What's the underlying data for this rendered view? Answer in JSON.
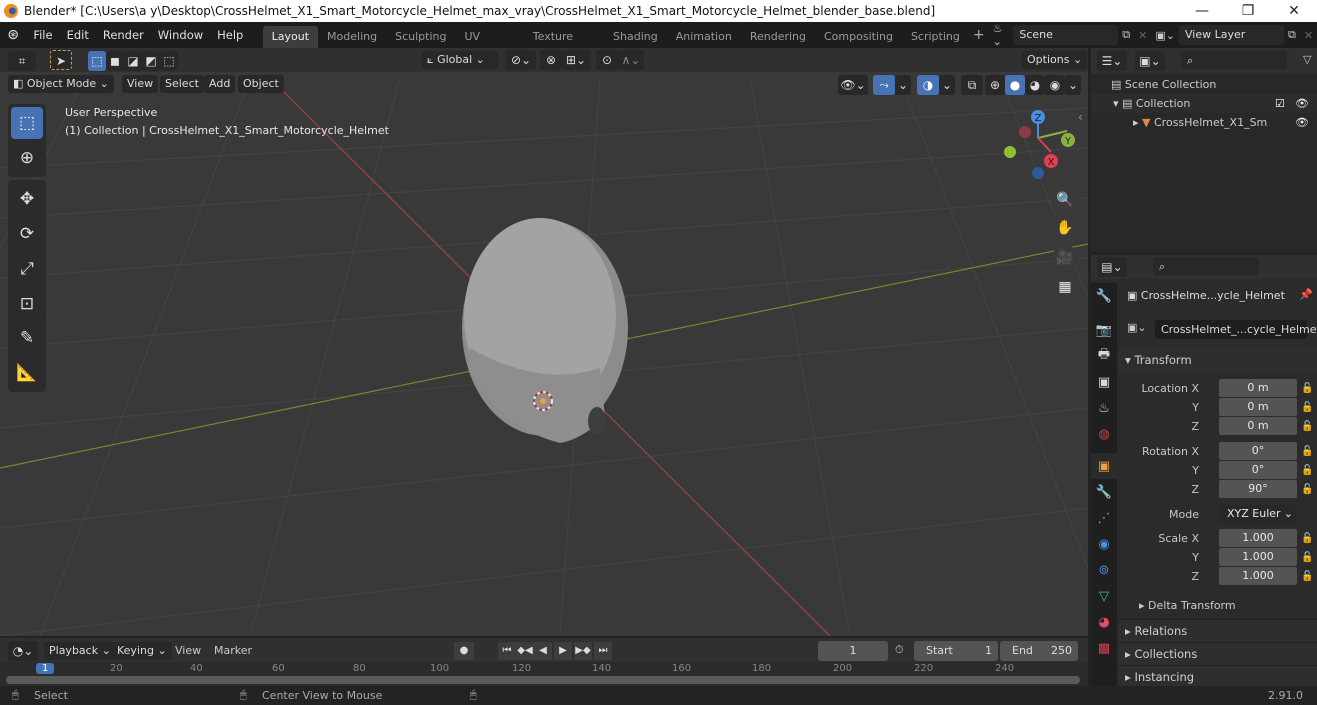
{
  "window": {
    "title": "Blender* [C:\\Users\\a y\\Desktop\\CrossHelmet_X1_Smart_Motorcycle_Helmet_max_vray\\CrossHelmet_X1_Smart_Motorcycle_Helmet_blender_base.blend]",
    "minimize": "—",
    "maximize": "❐",
    "close": "✕"
  },
  "menu": [
    "File",
    "Edit",
    "Render",
    "Window",
    "Help"
  ],
  "workspaces": [
    "Layout",
    "Modeling",
    "Sculpting",
    "UV Editing",
    "Texture Paint",
    "Shading",
    "Animation",
    "Rendering",
    "Compositing",
    "Scripting"
  ],
  "add_workspace": "+",
  "scene": {
    "value": "Scene"
  },
  "view_layer": {
    "value": "View Layer"
  },
  "viewport_header": {
    "mode": "Object Mode",
    "menus": [
      "View",
      "Select",
      "Add",
      "Object"
    ],
    "orientation": "Global",
    "options": "Options"
  },
  "viewport": {
    "perspective": "User Perspective",
    "collection_info": "(1) Collection | CrossHelmet_X1_Smart_Motorcycle_Helmet",
    "gizmo": {
      "x": "X",
      "y": "Y",
      "z": "Z"
    }
  },
  "outliner": {
    "search_placeholder": "",
    "items": [
      {
        "label": "Scene Collection",
        "icon": "scene-collection-icon"
      },
      {
        "label": "Collection",
        "icon": "collection-icon",
        "checked": true
      },
      {
        "label": "CrossHelmet_X1_Sm",
        "icon": "mesh-object-icon"
      }
    ]
  },
  "properties": {
    "search_placeholder": "",
    "object_name": "CrossHelme...ycle_Helmet",
    "object_field": "CrossHelmet_...cycle_Helmet",
    "transform_header": "Transform",
    "location": {
      "label": "Location X",
      "x": "0 m",
      "y": "0 m",
      "z": "0 m"
    },
    "rotation": {
      "label": "Rotation X",
      "x": "0°",
      "y": "0°",
      "z": "90°"
    },
    "mode": {
      "label": "Mode",
      "value": "XYZ Euler"
    },
    "scale": {
      "label": "Scale X",
      "x": "1.000",
      "y": "1.000",
      "z": "1.000"
    },
    "axis_y": "Y",
    "axis_z": "Z",
    "delta": "Delta Transform",
    "panels": [
      "Relations",
      "Collections",
      "Instancing"
    ]
  },
  "timeline": {
    "menus": [
      "Playback",
      "Keying",
      "View",
      "Marker"
    ],
    "current_frame": "1",
    "start_label": "Start",
    "start": "1",
    "end_label": "End",
    "end": "250",
    "ticks": [
      "1",
      "20",
      "40",
      "60",
      "80",
      "100",
      "120",
      "140",
      "160",
      "180",
      "200",
      "220",
      "240"
    ]
  },
  "status": {
    "select": "Select",
    "center": "Center View to Mouse",
    "version": "2.91.0"
  }
}
